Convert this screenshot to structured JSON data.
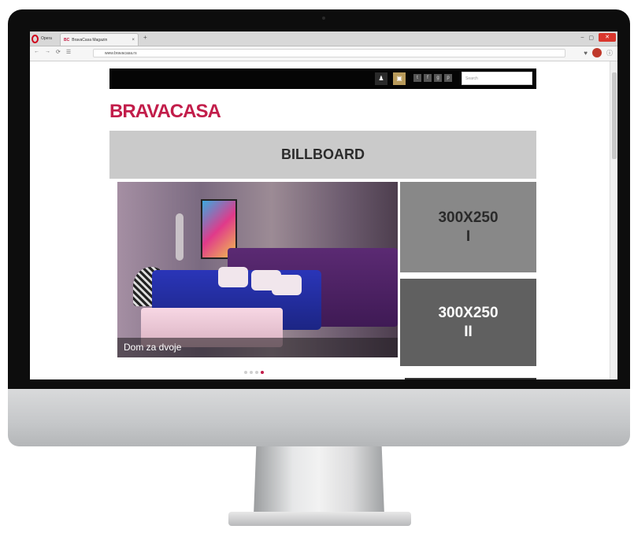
{
  "browser": {
    "menu_label": "Opera",
    "tab": {
      "favicon": "BC",
      "title": "BravaCasa Magazin",
      "close": "×"
    },
    "new_tab": "+",
    "window_controls": {
      "minimize": "–",
      "maximize": "▢",
      "close": "✕"
    },
    "nav": {
      "back": "←",
      "forward": "→",
      "reload": "⟳",
      "speed_dial": "☰"
    },
    "url": "www.bravacasa.rs",
    "icons": [
      "heart-icon",
      "extension-icon",
      "menu-icon"
    ]
  },
  "site": {
    "search_placeholder": "Search",
    "logo": "BRAVACASA",
    "brand_color": "#c21d4a",
    "social_icons": [
      "twitter-icon",
      "facebook-icon",
      "google-icon",
      "pinterest-icon"
    ],
    "billboard_label": "BILLBOARD",
    "hero_caption": "Dom za dvoje",
    "ad1": {
      "line1": "300X250",
      "line2": "I"
    },
    "ad2": {
      "line1": "300X250",
      "line2": "II"
    },
    "slider": {
      "count": 4,
      "active": 4
    }
  }
}
